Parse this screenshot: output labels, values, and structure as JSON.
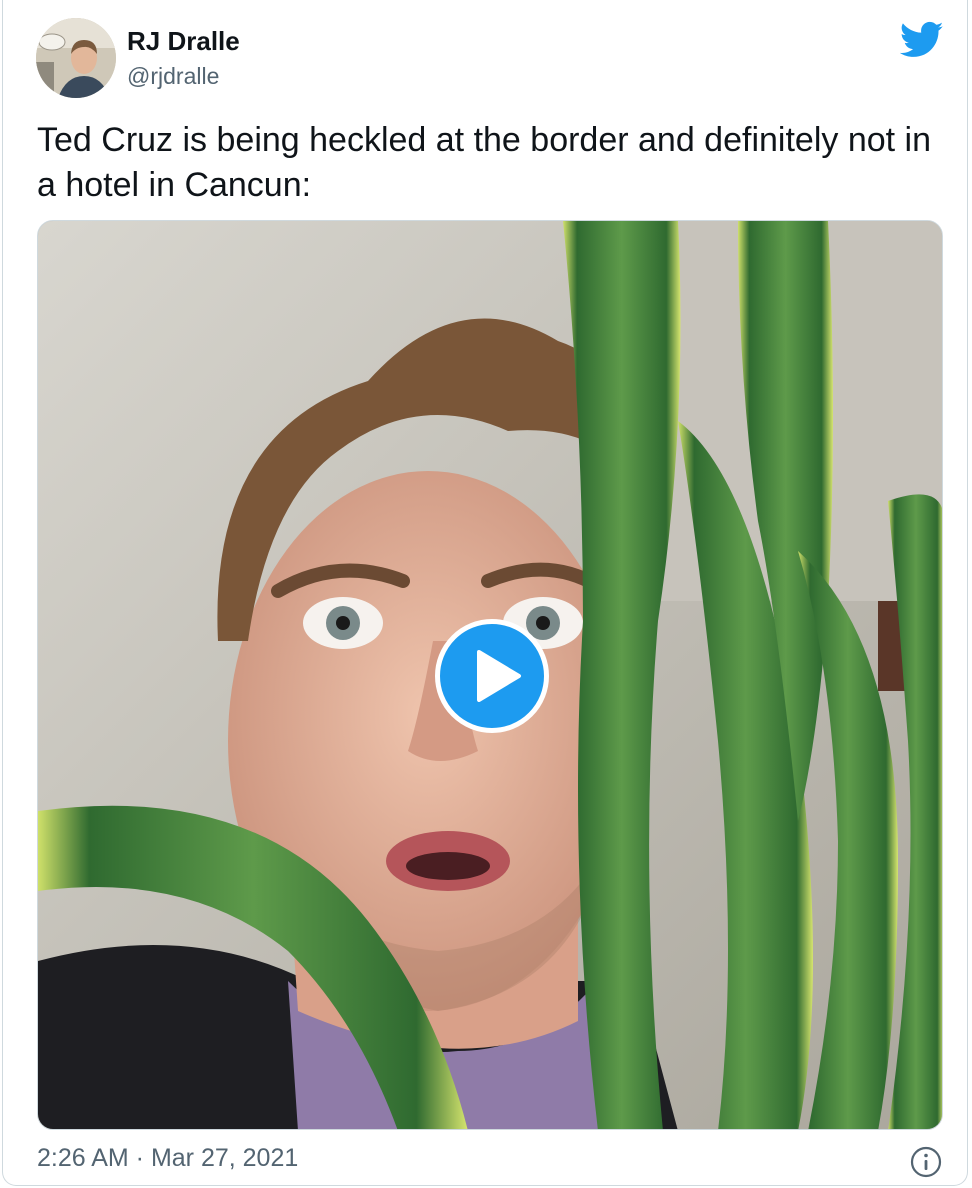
{
  "author": {
    "name": "RJ Dralle",
    "handle": "@rjdralle"
  },
  "tweet": {
    "text": "Ted Cruz is being heckled at the border and definitely not in a hotel in Cancun:",
    "timestamp": "2:26 AM · Mar 27, 2021"
  },
  "icons": {
    "platform": "twitter-bird-icon",
    "play": "play-icon",
    "info": "info-icon"
  },
  "colors": {
    "twitter_blue": "#1d9bf0",
    "text_primary": "#0f1419",
    "text_secondary": "#536471",
    "border": "#cfd9de"
  }
}
